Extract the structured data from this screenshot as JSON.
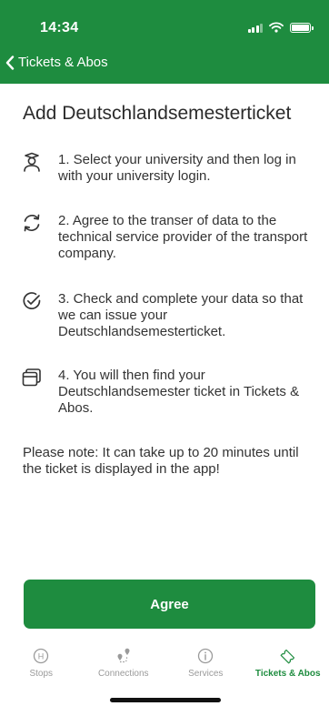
{
  "status_bar": {
    "time": "14:34"
  },
  "nav": {
    "back_label": "Tickets & Abos"
  },
  "page": {
    "title": "Add Deutschlandsemesterticket",
    "steps": [
      {
        "icon": "student-icon",
        "text": "1. Select your university and then log in with your university login."
      },
      {
        "icon": "sync-icon",
        "text": "2. Agree to the transer of data to the technical service provider of the transport company."
      },
      {
        "icon": "check-circle-icon",
        "text": "3. Check and complete your data so that we can issue your Deutschlandsemesterticket."
      },
      {
        "icon": "tickets-icon",
        "text": "4. You will then find your Deutschlandsemester ticket in Tickets & Abos."
      }
    ],
    "note": "Please note: It can take up to 20 minutes until the ticket is displayed in the app!",
    "agree_label": "Agree"
  },
  "tabbar": {
    "items": [
      {
        "label": "Stops",
        "icon": "stop-h-icon",
        "active": false
      },
      {
        "label": "Connections",
        "icon": "route-pins-icon",
        "active": false
      },
      {
        "label": "Services",
        "icon": "info-icon",
        "active": false
      },
      {
        "label": "Tickets & Abos",
        "icon": "ticket-icon",
        "active": true
      }
    ]
  },
  "colors": {
    "brand_green": "#1e8c3f",
    "inactive_gray": "#9a9a9a"
  }
}
